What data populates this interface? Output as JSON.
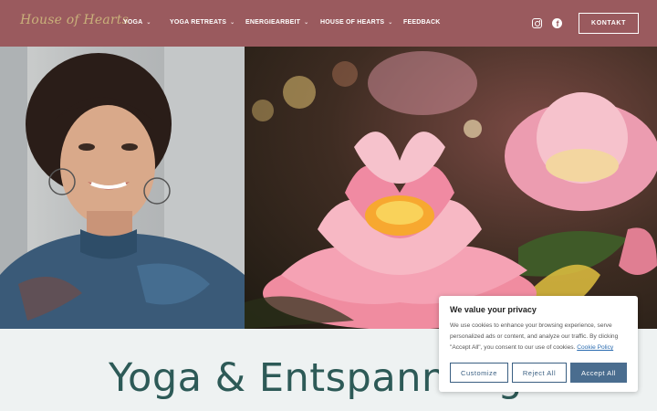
{
  "header": {
    "logo_text": "House of Hearts",
    "nav": [
      {
        "label": "YOGA"
      },
      {
        "label": "YOGA RETREATS"
      },
      {
        "label": "ENERGIEARBEIT"
      },
      {
        "label": "HOUSE OF HEARTS"
      },
      {
        "label": "FEEDBACK"
      }
    ],
    "social": {
      "instagram": "instagram-icon",
      "facebook": "facebook-icon",
      "facebook_glyph": "f"
    },
    "contact_label": "KONTAKT",
    "colors": {
      "bar": "#9a5a5e",
      "logo": "#c9b07a"
    }
  },
  "hero": {
    "left_image": "portrait-photo",
    "right_image": "lotus-flower-photo"
  },
  "main": {
    "headline": "Yoga & Entspannung"
  },
  "cookie": {
    "title": "We value your privacy",
    "text": "We use cookies to enhance your browsing experience, serve personalized ads or content, and analyze our traffic. By clicking \"Accept All\", you consent to our use of cookies.",
    "policy_link": "Cookie Policy",
    "customize_label": "Customize",
    "reject_label": "Reject All",
    "accept_label": "Accept All",
    "colors": {
      "button_primary": "#4a6d8f",
      "button_border": "#3a5f82"
    }
  }
}
